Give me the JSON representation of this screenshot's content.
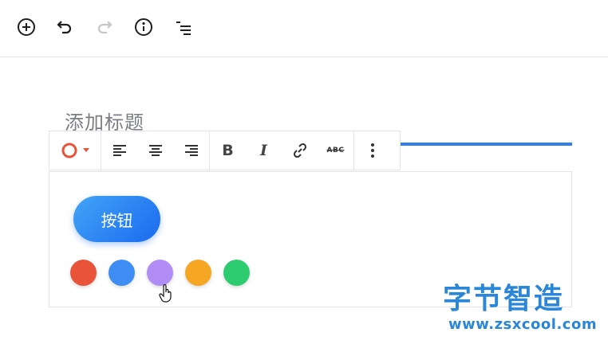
{
  "toolbar": {
    "add": "add-block",
    "undo": "undo",
    "redo": "redo",
    "info": "info",
    "outline": "outline"
  },
  "editor": {
    "title_placeholder": "添加标题"
  },
  "block_toolbar": {
    "color_icon": "circle-color-icon",
    "align": [
      "align-left",
      "align-center",
      "align-right"
    ],
    "bold": "B",
    "italic": "I",
    "link": "link",
    "strike": "ABC",
    "more": "more"
  },
  "button_block": {
    "label": "按钮",
    "gradient": [
      "#42a4f5",
      "#1a6af0"
    ]
  },
  "swatches": [
    {
      "name": "red",
      "color": "#e8533a"
    },
    {
      "name": "blue",
      "color": "#3d8df5"
    },
    {
      "name": "purple",
      "color": "#b28cf5"
    },
    {
      "name": "orange",
      "color": "#f5a623"
    },
    {
      "name": "green",
      "color": "#2ecc71"
    }
  ],
  "watermark": {
    "title": "字节智造",
    "url": "www.zsxcool.com"
  }
}
